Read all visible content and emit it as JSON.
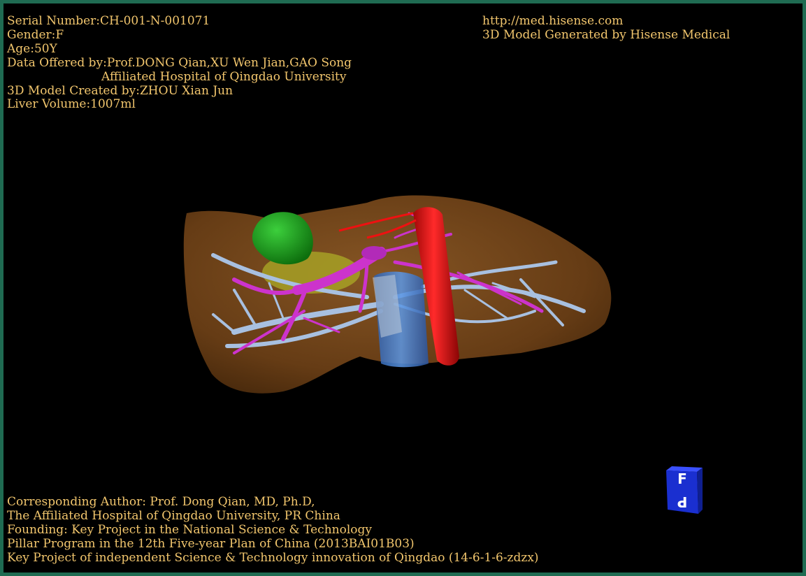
{
  "info": {
    "serial_number": "Serial Number:CH-001-N-001071",
    "gender": "Gender:F",
    "age": "Age:50Y",
    "data_offered_by": "Data Offered by:Prof.DONG Qian,XU Wen Jian,GAO Song",
    "hospital": "Affiliated Hospital of Qingdao University",
    "model_created_by": "3D Model Created by:ZHOU Xian Jun",
    "liver_volume": "Liver Volume:1007ml"
  },
  "header_right": {
    "url": "http://med.hisense.com",
    "generator": "3D Model Generated by Hisense Medical"
  },
  "footer": {
    "lines": [
      "Corresponding Author: Prof. Dong Qian, MD, Ph.D,",
      "The Affiliated Hospital of Qingdao University, PR China",
      "Founding: Key Project in the National Science & Technology",
      "Pillar Program in the 12th Five-year Plan of China (2013BAI01B03)",
      "Key Project of independent Science & Technology innovation of Qingdao (14-6-1-6-zdzx)"
    ]
  },
  "orientation_cube": {
    "top_face_label": "F",
    "side_face_label": "P"
  },
  "colors": {
    "text": "#f2c66d",
    "frame": "#1f6b52",
    "liver": "#7a4a1e",
    "gallbladder": "#1aa11a",
    "aorta_ivc": "#dd1111",
    "portal_vein": "#cc33cc",
    "hepatic_veins": "#a8c0e0",
    "ivc_blue": "#4a86d8",
    "cube": "#1a2fd0"
  }
}
